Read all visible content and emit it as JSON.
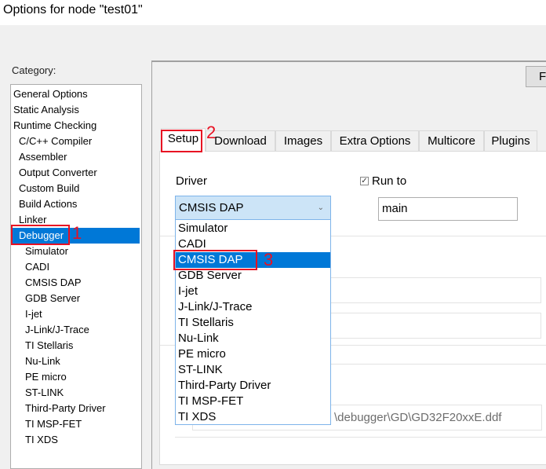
{
  "window": {
    "title": "Options for node \"test01\""
  },
  "category": {
    "label": "Category:",
    "items": [
      {
        "label": "General Options",
        "level": 0
      },
      {
        "label": "Static Analysis",
        "level": 0
      },
      {
        "label": "Runtime Checking",
        "level": 0
      },
      {
        "label": "C/C++ Compiler",
        "level": 1
      },
      {
        "label": "Assembler",
        "level": 1
      },
      {
        "label": "Output Converter",
        "level": 1
      },
      {
        "label": "Custom Build",
        "level": 1
      },
      {
        "label": "Build Actions",
        "level": 1
      },
      {
        "label": "Linker",
        "level": 1
      },
      {
        "label": "Debugger",
        "level": 1,
        "selected": true
      },
      {
        "label": "Simulator",
        "level": 2
      },
      {
        "label": "CADI",
        "level": 2
      },
      {
        "label": "CMSIS DAP",
        "level": 2
      },
      {
        "label": "GDB Server",
        "level": 2
      },
      {
        "label": "I-jet",
        "level": 2
      },
      {
        "label": "J-Link/J-Trace",
        "level": 2
      },
      {
        "label": "TI Stellaris",
        "level": 2
      },
      {
        "label": "Nu-Link",
        "level": 2
      },
      {
        "label": "PE micro",
        "level": 2
      },
      {
        "label": "ST-LINK",
        "level": 2
      },
      {
        "label": "Third-Party Driver",
        "level": 2
      },
      {
        "label": "TI MSP-FET",
        "level": 2
      },
      {
        "label": "TI XDS",
        "level": 2
      }
    ]
  },
  "factory_button": {
    "label": "F"
  },
  "tabs": [
    {
      "label": "Setup",
      "active": true
    },
    {
      "label": "Download"
    },
    {
      "label": "Images"
    },
    {
      "label": "Extra Options"
    },
    {
      "label": "Multicore"
    },
    {
      "label": "Plugins"
    }
  ],
  "setup": {
    "driver_label": "Driver",
    "driver_value": "CMSIS DAP",
    "driver_options": [
      "Simulator",
      "CADI",
      "CMSIS DAP",
      "GDB Server",
      "I-jet",
      "J-Link/J-Trace",
      "TI Stellaris",
      "Nu-Link",
      "PE micro",
      "ST-LINK",
      "Third-Party Driver",
      "TI MSP-FET",
      "TI XDS"
    ],
    "driver_selected_index": 2,
    "run_to_label": "Run to",
    "run_to_checked": true,
    "run_to_value": "main",
    "device_description_file": "\\debugger\\GD\\GD32F20xxE.ddf"
  },
  "annotations": {
    "step1": "1",
    "step2": "2",
    "step3": "3",
    "color": "#e81123"
  },
  "colors": {
    "selection": "#0078d7",
    "combo_bg": "#cce4f7"
  }
}
